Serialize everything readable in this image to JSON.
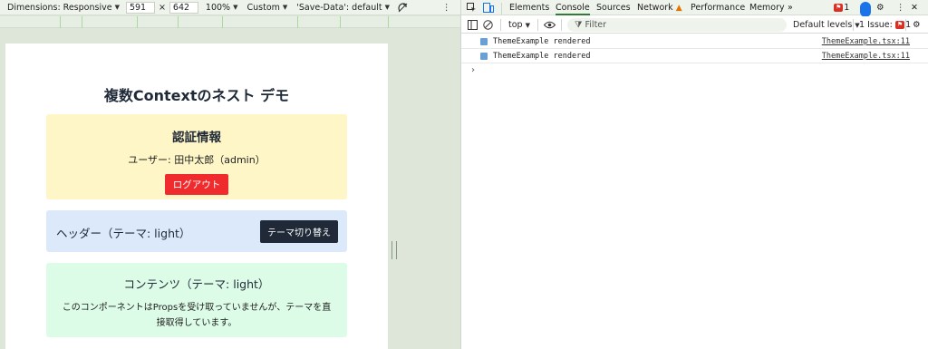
{
  "device_toolbar": {
    "dimensions_label": "Dimensions: Responsive",
    "width": "591",
    "times": "×",
    "height": "642",
    "zoom": "100%",
    "throttle": "Custom",
    "save_data": "'Save-Data': default"
  },
  "app": {
    "title": "複数Contextのネスト デモ",
    "auth": {
      "heading": "認証情報",
      "user_line": "ユーザー: 田中太郎（admin）",
      "logout_label": "ログアウト"
    },
    "header": {
      "title": "ヘッダー（テーマ: light）",
      "toggle_label": "テーマ切り替え"
    },
    "content": {
      "heading": "コンテンツ（テーマ: light）",
      "body": "このコンポーネントはPropsを受け取っていませんが、テーマを直接取得しています。"
    }
  },
  "devtools": {
    "tabs": [
      "Elements",
      "Console",
      "Sources",
      "Network",
      "Performance",
      "Memory"
    ],
    "active_tab": "Console",
    "more": "»",
    "issue_badge_count": "1",
    "filter_bar": {
      "context": "top",
      "filter_placeholder": "Filter",
      "levels": "Default levels",
      "issues_label": "1 Issue:",
      "issues_count": "1"
    },
    "logs": [
      {
        "message": "ThemeExample rendered",
        "source": "ThemeExample.tsx:11"
      },
      {
        "message": "ThemeExample rendered",
        "source": "ThemeExample.tsx:11"
      }
    ],
    "prompt": "›"
  },
  "colors": {
    "toolbar_bg": "#eef3ec",
    "auth_card": "#fef6c6",
    "header_card": "#dbe9fb",
    "content_card": "#dcfce7",
    "logout_button": "#ef2b2d",
    "theme_button": "#1f2937",
    "active_tab_underline": "#2e7d32"
  }
}
